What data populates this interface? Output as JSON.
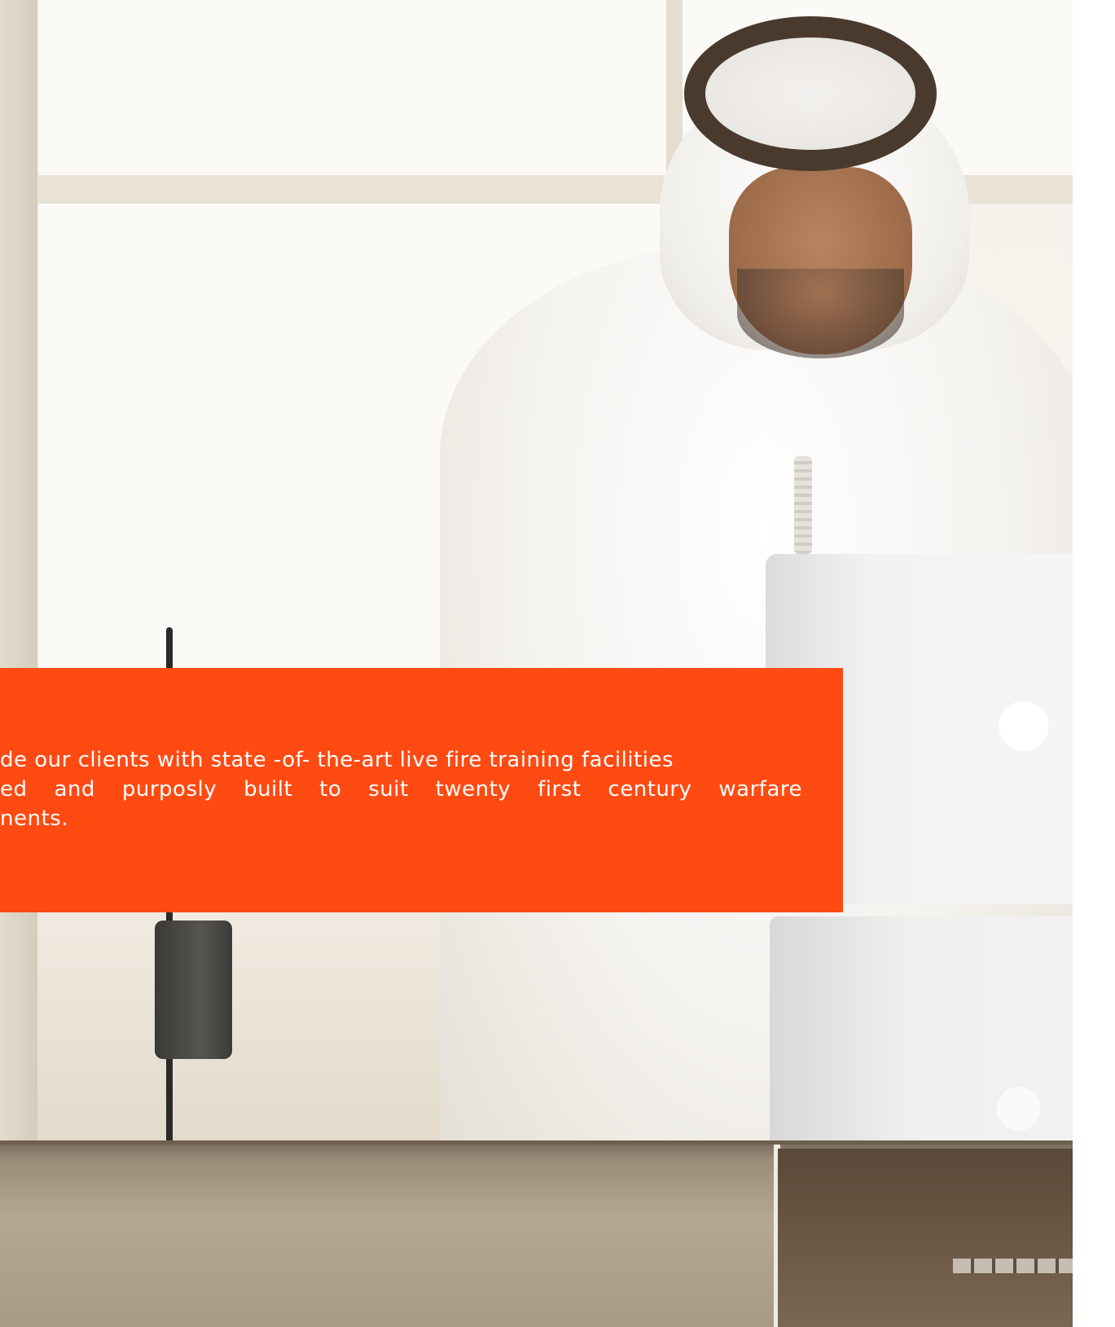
{
  "hero": {
    "image_alt": "Man in traditional white kandura and ghutra with agal working at a laptop",
    "icons": {
      "laptop_logo_top": "apple-logo-icon",
      "laptop_logo_bottom": "apple-logo-icon"
    }
  },
  "mission": {
    "lines": [
      "de our clients with state -of- the-art live fire training facilities",
      "ed and purposly built to suit twenty first century warfare",
      "nents."
    ]
  },
  "colors": {
    "accent": "#ff4a12",
    "text_on_accent": "#ffffff"
  }
}
